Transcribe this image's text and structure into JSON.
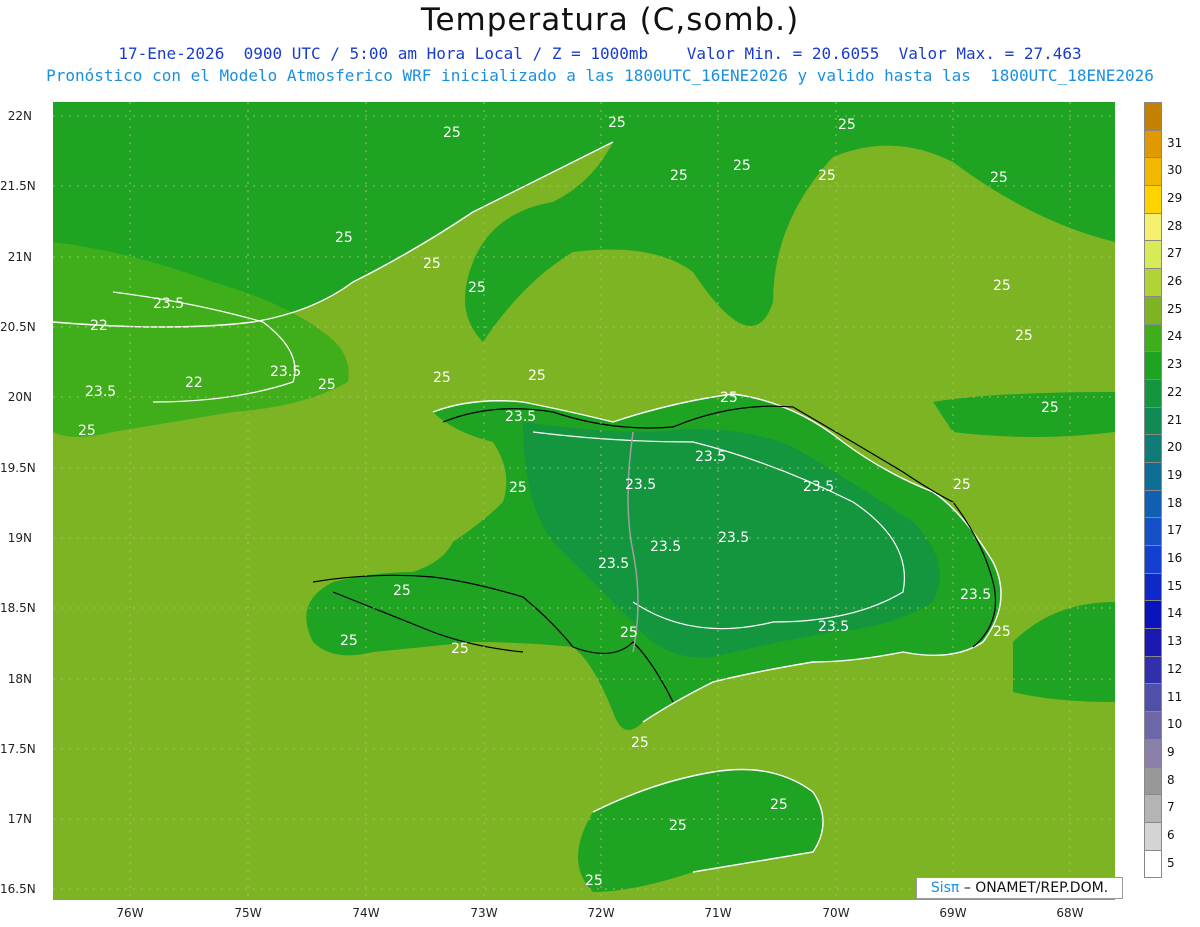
{
  "header": {
    "title": "Temperatura (C,somb.)",
    "line1": "17-Ene-2026  0900 UTC / 5:00 am Hora Local / Z = 1000mb    Valor Min. = 20.6055  Valor Max. = 27.463",
    "line2": "Pronóstico con el Modelo Atmosferico WRF inicializado a las 1800UTC_16ENE2026 y valido hasta las  1800UTC_18ENE2026"
  },
  "lat_labels": [
    "22N",
    "21.5N",
    "21N",
    "20.5N",
    "20N",
    "19.5N",
    "19N",
    "18.5N",
    "18N",
    "17.5N",
    "17N",
    "16.5N"
  ],
  "lon_labels": [
    "76W",
    "75W",
    "74W",
    "73W",
    "72W",
    "71W",
    "70W",
    "69W",
    "68W"
  ],
  "contour_labels": [
    "25",
    "23.5",
    "22"
  ],
  "credit": {
    "prefix": "Sis",
    "pi": "π",
    "suffix": "– ONAMET/REP.DOM."
  },
  "colorbar": {
    "levels": [
      "5",
      "6",
      "7",
      "8",
      "9",
      "10",
      "11",
      "12",
      "13",
      "14",
      "15",
      "16",
      "17",
      "18",
      "19",
      "20",
      "21",
      "22",
      "23",
      "24",
      "25",
      "26",
      "27",
      "28",
      "29",
      "30",
      "31"
    ],
    "colors": [
      "#c48000",
      "#e09a00",
      "#f2b800",
      "#ffd200",
      "#f5f070",
      "#d8ea56",
      "#b0d436",
      "#7cb424",
      "#3fae1a",
      "#1ea322",
      "#14963e",
      "#128a55",
      "#107c78",
      "#0f6e96",
      "#1060b2",
      "#1450c6",
      "#1440d2",
      "#0f28c8",
      "#0a14bc",
      "#1a1ab0",
      "#3030ac",
      "#5050a8",
      "#6e68a8",
      "#8a80aa",
      "#989898",
      "#b4b4b4",
      "#d4d4d4",
      "#ffffff"
    ]
  },
  "map_colors": {
    "ocean": "#7cb424",
    "land_warm": "#3fae1a",
    "land_cool": "#1ea322",
    "inland": "#14963e",
    "contour": "#ffffff",
    "coast": "#000000",
    "border": "#a0a0a0"
  }
}
